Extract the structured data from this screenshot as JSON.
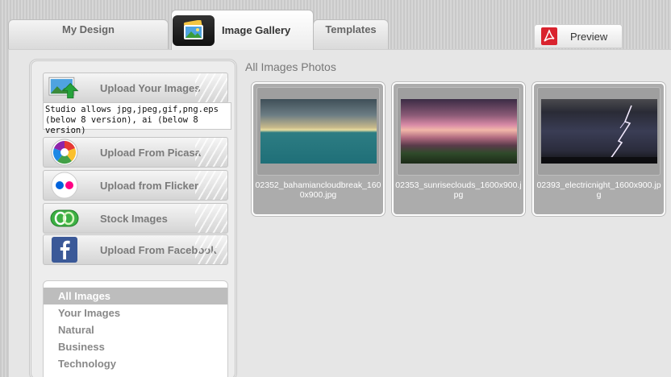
{
  "tabs": {
    "my_design": "My Design",
    "image_gallery": "Image Gallery",
    "templates": "Templates",
    "preview": "Preview"
  },
  "sidebar": {
    "upload_images": "Upload Your Images",
    "info_line1": "Studio allows jpg,jpeg,gif,png.eps",
    "info_line2": "(below 8 version), ai (below 8 version)",
    "upload_picasa": "Upload From Picasa",
    "upload_flicker": "Upload from Flicker",
    "stock_images": "Stock Images",
    "upload_facebook": "Upload From Facebook",
    "categories": [
      "All Images",
      "Your Images",
      "Natural",
      "Business",
      "Technology"
    ],
    "active_category": "All Images"
  },
  "gallery": {
    "title": "All Images Photos",
    "photos": [
      {
        "name": "02352_bahamiancloudbreak_1600x900.jpg"
      },
      {
        "name": "02353_sunriseclouds_1600x900.jpg"
      },
      {
        "name": "02393_electricnight_1600x900.jpg"
      }
    ]
  },
  "icons": {
    "gallery_tab": "photos-icon",
    "preview": "pdf-icon",
    "upload": "upload-arrow-icon",
    "picasa": "picasa-icon",
    "flicker": "flickr-icon",
    "stock": "stock-images-icon",
    "facebook": "facebook-icon"
  },
  "colors": {
    "accent_red": "#d9232e",
    "upload_green": "#26a33b",
    "facebook_blue": "#3b5998",
    "flickr_blue": "#0063dc",
    "flickr_pink": "#ff0084"
  }
}
